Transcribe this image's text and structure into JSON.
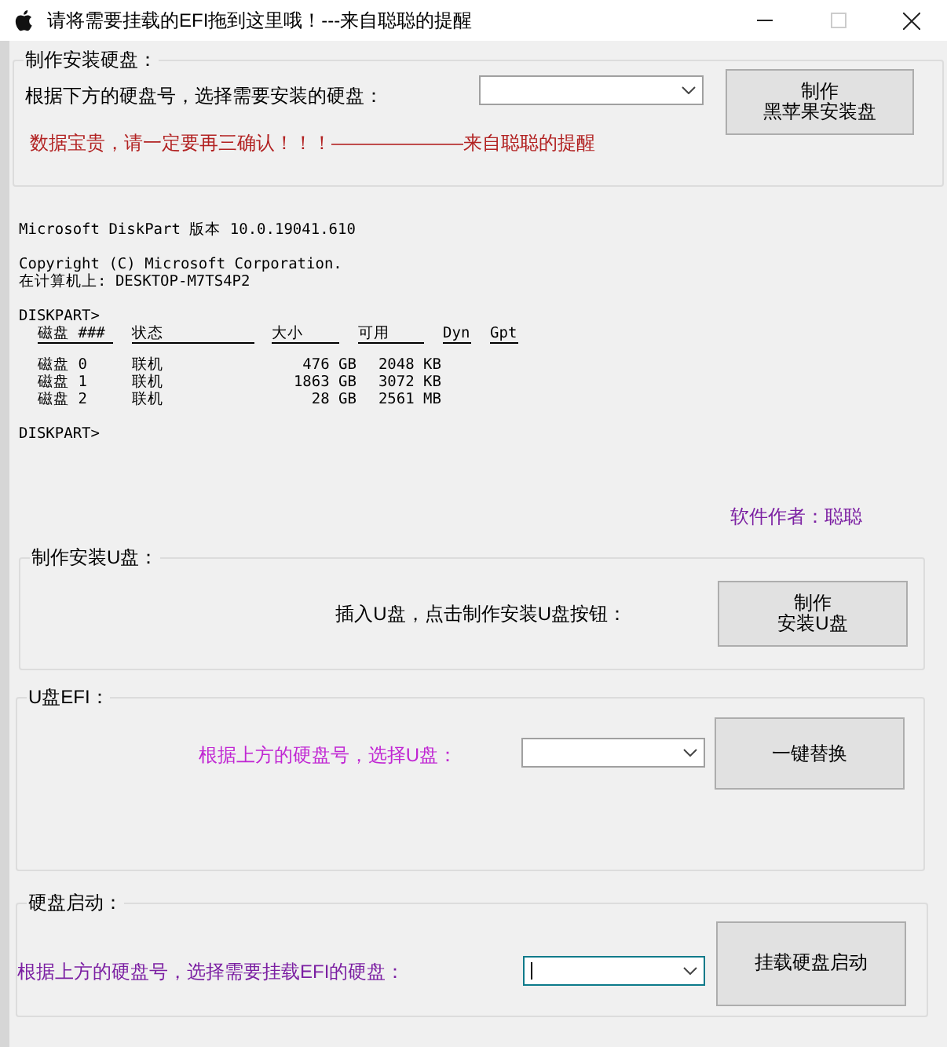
{
  "window": {
    "title": "请将需要挂载的EFI拖到这里哦！---来自聪聪的提醒"
  },
  "groups": [
    {
      "kind": "disk",
      "legend": "制作安装硬盘：",
      "label": "根据下方的硬盘号，选择需要安装的硬盘：",
      "combo": {
        "focused": false
      },
      "button": [
        "制作",
        "黑苹果安装盘"
      ],
      "warning": "数据宝贵，请一定要再三确认！！！———————来自聪聪的提醒"
    },
    {
      "kind": "console",
      "intro": [
        [
          "Microsoft DiskPart 版本 10.0.19041.610"
        ],
        [
          "Copyright (C) Microsoft Corporation.",
          "在计算机上: DESKTOP-M7TS4P2"
        ],
        [
          "DISKPART>"
        ]
      ],
      "headers": [
        "磁盘 ###",
        "状态",
        "大小",
        "可用",
        "Dyn",
        "Gpt"
      ],
      "rows": [
        [
          "磁盘 0",
          "联机",
          "476 GB",
          "2048 KB"
        ],
        [
          "磁盘 1",
          "联机",
          "1863 GB",
          "3072 KB"
        ],
        [
          "磁盘 2",
          "联机",
          "28 GB",
          "2561 MB"
        ]
      ],
      "prompt": "DISKPART>",
      "author": "软件作者：聪聪"
    },
    {
      "kind": "usb",
      "legend": "制作安装U盘：",
      "label": "插入U盘，点击制作安装U盘按钮：",
      "button": [
        "制作",
        "安装U盘"
      ]
    },
    {
      "kind": "efi",
      "legend": "U盘EFI：",
      "label": "根据上方的硬盘号，选择U盘：",
      "combo": {
        "focused": false
      },
      "button": [
        "一键替换"
      ]
    },
    {
      "kind": "boot",
      "legend": "硬盘启动：",
      "label": "根据上方的硬盘号，选择需要挂载EFI的硬盘：",
      "combo": {
        "focused": true
      },
      "button": [
        "挂载硬盘启动"
      ]
    }
  ]
}
